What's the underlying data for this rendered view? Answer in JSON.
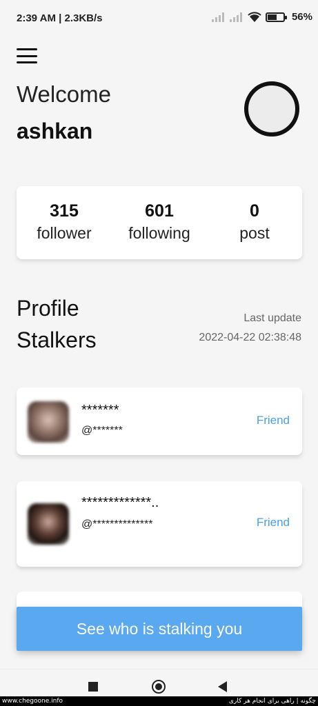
{
  "status": {
    "time": "2:39 AM | 2.3KB/s",
    "battery": "56%"
  },
  "header": {
    "welcome": "Welcome",
    "username": "ashkan"
  },
  "stats": [
    {
      "value": "315",
      "label": "follower"
    },
    {
      "value": "601",
      "label": "following"
    },
    {
      "value": "0",
      "label": "post"
    }
  ],
  "stalkers": {
    "title_line1": "Profile",
    "title_line2": "Stalkers",
    "last_update_label": "Last update",
    "last_update_value": "2022-04-22 02:38:48",
    "items": [
      {
        "name": "*******",
        "handle": "@*******",
        "tag": "Friend"
      },
      {
        "name": "*************..",
        "handle": "@**************",
        "tag": "Friend"
      }
    ]
  },
  "cta": {
    "label": "See who is stalking you"
  },
  "icons": [
    "menu-icon",
    "wifi-icon",
    "signal-icon",
    "battery-icon",
    "recent-apps-icon",
    "home-icon",
    "back-icon"
  ],
  "footer": {
    "left": "www.chegoone.info",
    "right": "چگونه | راهی برای انجام هر کاری"
  },
  "colors": {
    "accent": "#5aa8f0",
    "tag": "#4a9fe8",
    "background": "#f5f5f5"
  }
}
